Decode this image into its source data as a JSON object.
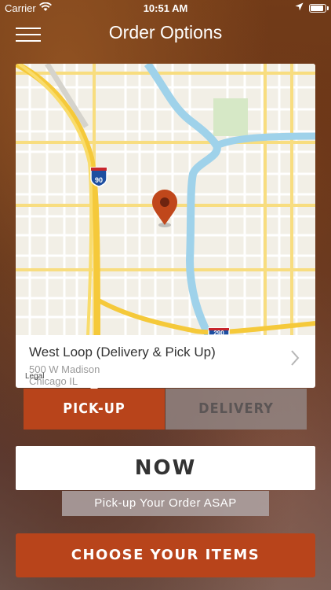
{
  "status_bar": {
    "carrier": "Carrier",
    "time": "10:51 AM"
  },
  "header": {
    "title": "Order Options"
  },
  "map": {
    "highway_labels": [
      "90",
      "290"
    ],
    "legal": "Legal"
  },
  "location": {
    "name": "West Loop (Delivery & Pick Up)",
    "address_line1": "500 W Madison",
    "address_line2": "Chicago IL"
  },
  "order_type": {
    "pickup_label": "PICK-UP",
    "delivery_label": "DELIVERY",
    "selected": "PICK-UP"
  },
  "timing": {
    "now_label": "NOW",
    "description": "Pick-up Your Order ASAP"
  },
  "actions": {
    "choose_items_label": "CHOOSE YOUR ITEMS"
  },
  "colors": {
    "accent": "#b8441b",
    "river": "#7ec8e8",
    "highway": "#f5cc45",
    "pin": "#c0471b"
  }
}
